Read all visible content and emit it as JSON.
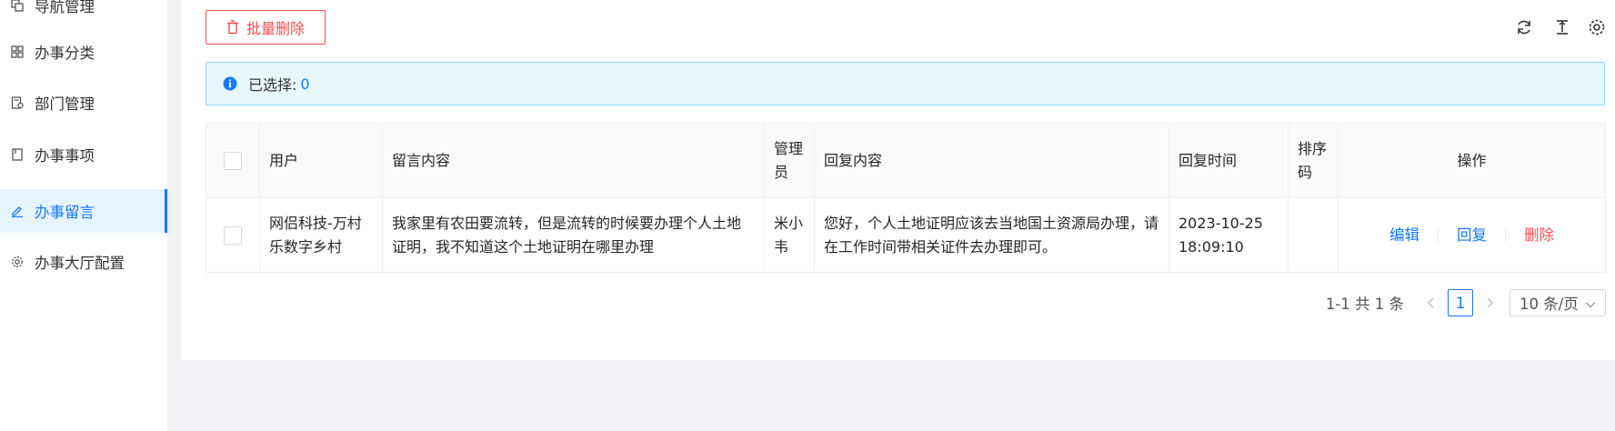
{
  "sidebar": {
    "items": [
      {
        "label": "导航管理",
        "icon": "copy-icon"
      },
      {
        "label": "办事分类",
        "icon": "grid-icon"
      },
      {
        "label": "部门管理",
        "icon": "audit-icon"
      },
      {
        "label": "办事事项",
        "icon": "book-icon"
      },
      {
        "label": "办事留言",
        "icon": "edit-icon",
        "active": true
      },
      {
        "label": "办事大厅配置",
        "icon": "setting-icon"
      }
    ]
  },
  "toolbar": {
    "batch_delete_label": "批量删除",
    "icons": [
      "reload-icon",
      "column-height-icon",
      "setting-icon"
    ]
  },
  "alert": {
    "selected_label": "已选择:",
    "selected_count": "0"
  },
  "table": {
    "columns": [
      "用户",
      "留言内容",
      "管理员",
      "回复内容",
      "回复时间",
      "排序码",
      "操作"
    ],
    "rows": [
      {
        "user": "网侣科技-万村乐数字乡村",
        "message": "我家里有农田要流转，但是流转的时候要办理个人土地证明，我不知道这个土地证明在哪里办理",
        "admin": "米小韦",
        "reply": "您好，个人土地证明应该去当地国土资源局办理，请在工作时间带相关证件去办理即可。",
        "reply_time": "2023-10-25 18:09:10",
        "sort_code": "",
        "actions": {
          "edit": "编辑",
          "reply": "回复",
          "delete": "删除"
        }
      }
    ]
  },
  "pagination": {
    "total_text": "1-1 共 1 条",
    "current_page": "1",
    "page_size": "10 条/页"
  },
  "colors": {
    "primary": "#1677ff",
    "danger": "#ff4d4f",
    "alert_bg": "#e6f7ff",
    "page_bg": "#f0f2f5"
  }
}
